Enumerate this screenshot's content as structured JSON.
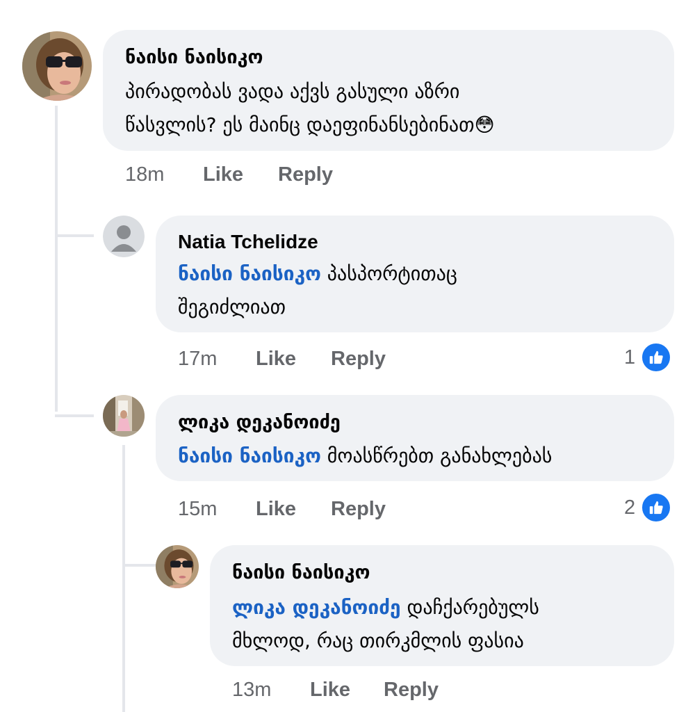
{
  "colors": {
    "bubble": "#f0f2f5",
    "mention": "#1b62c4",
    "meta_text": "#65676b",
    "like_blue": "#1877f2",
    "thread_line": "#e4e6eb"
  },
  "comments": [
    {
      "author": "ნაისი ნაისიკო",
      "text_lines": [
        "პირადობას ვადა აქვს გასული აზრი",
        "წასვლის? ეს მაინც დაეფინანსებინათ"
      ],
      "emoji": "😳",
      "time": "18m",
      "like_label": "Like",
      "reply_label": "Reply"
    },
    {
      "author": "Natia Tchelidze",
      "mention": "ნაისი ნაისიკო",
      "text_lines": [
        "პასპორტითაც",
        "შეგიძლიათ"
      ],
      "time": "17m",
      "like_label": "Like",
      "reply_label": "Reply",
      "reaction_count": "1",
      "reaction_icon": "thumbs-up-icon"
    },
    {
      "author": "ლიკა დეკანოიძე",
      "mention": "ნაისი ნაისიკო",
      "text_lines": [
        "მოასწრებთ განახლებას"
      ],
      "time": "15m",
      "like_label": "Like",
      "reply_label": "Reply",
      "reaction_count": "2",
      "reaction_icon": "thumbs-up-icon"
    },
    {
      "author": "ნაისი ნაისიკო",
      "mention": "ლიკა დეკანოიძე",
      "text_lines": [
        "დაჩქარებულს",
        "მხლოდ, რაც თირკმლის ფასია"
      ],
      "time": "13m",
      "like_label": "Like",
      "reply_label": "Reply"
    }
  ]
}
